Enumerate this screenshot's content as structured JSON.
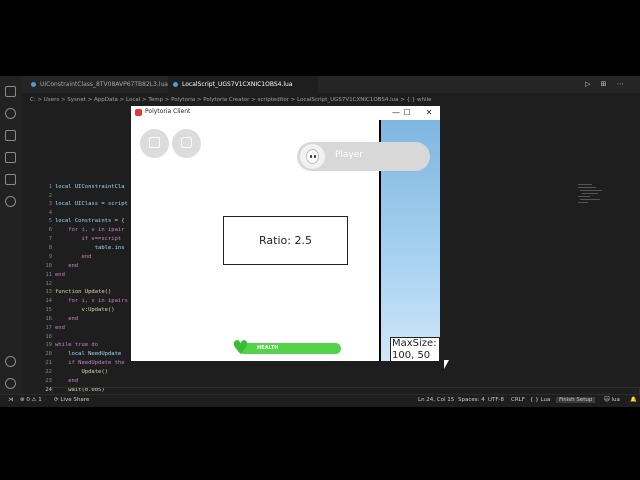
{
  "vscode": {
    "tabs": [
      {
        "label": "UIConstraintClass_8TV08AVP67TB82L3.lua",
        "active": false
      },
      {
        "label": "LocalScript_UGS7V1CXNIC1OBS4.lua",
        "active": true
      }
    ],
    "tab_actions": "▷ ⊞ ⋯",
    "breadcrumb": "C: > Users > Sysnet > AppData > Local > Temp > Polytoria > Polytoria Creator > scripteditor > LocalScript_UGS7V1CXNIC1OBS4.lua > { } while",
    "line_numbers": [
      "1",
      "2",
      "3",
      "4",
      "5",
      "6",
      "7",
      "8",
      "9",
      "10",
      "11",
      "12",
      "13",
      "14",
      "15",
      "16",
      "17",
      "18",
      "19",
      "20",
      "21",
      "22",
      "23",
      "24",
      "25"
    ],
    "current_line": "24",
    "code": {
      "l1": "local UIConstraintCla",
      "l3": "local UIClass = script",
      "l5": "local Constraints = {",
      "l6": "    for i, v in ipair",
      "l7": "        if v==script",
      "l8": "            table.ins",
      "l9": "        end",
      "l10": "    end",
      "l11": "end",
      "l13": "function Update()",
      "l14": "    for i, v in ipairs",
      "l15": "        v:Update()",
      "l16": "    end",
      "l17": "end",
      "l19": "while true do",
      "l20": "    local NeedUpdate",
      "l21": "    if NeedUpdate the",
      "l22": "        Update()",
      "l23": "    end",
      "l24": "    wait(0.005)",
      "l25": "end"
    },
    "status": {
      "errors": "⊗ 0 ⚠ 1",
      "live_share": "Live Share",
      "position": "Ln 24, Col 15",
      "spaces": "Spaces: 4",
      "encoding": "UTF-8",
      "eol": "CRLF",
      "language": "Lua",
      "finish_setup": "Finish Setup",
      "lua_badge": "lua"
    }
  },
  "client": {
    "title": "Polytoria Client",
    "window_controls": {
      "minimize": "—",
      "maximize": "☐",
      "close": "✕"
    },
    "player_name": "Player",
    "ratio_text": "Ratio: 2.5",
    "health_label": "HEALTH",
    "health_value": 1.0,
    "maxsize_text": "MaxSize: 100, 50"
  },
  "colors": {
    "health_green": "#54d24a",
    "sky_blue": "#a9d3f2",
    "editor_bg": "#1e1e1e"
  },
  "icons": [
    "files-icon",
    "search-icon",
    "source-control-icon",
    "run-icon",
    "extensions-icon",
    "remote-icon",
    "account-icon",
    "settings-icon",
    "chat-icon",
    "backpack-icon",
    "heart-icon"
  ]
}
